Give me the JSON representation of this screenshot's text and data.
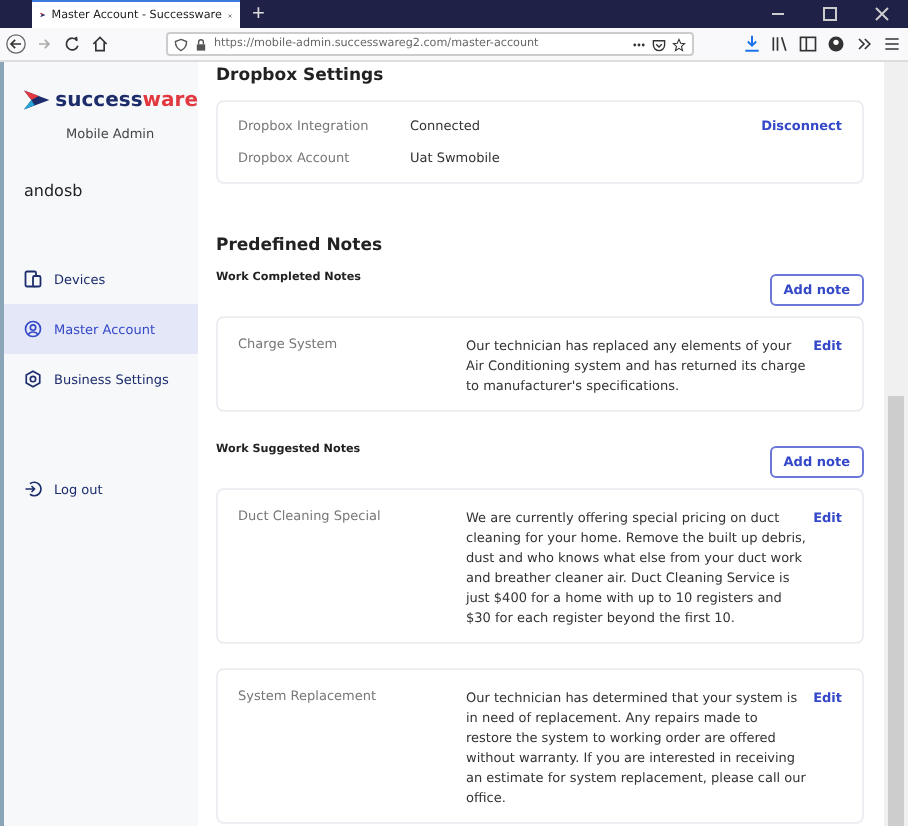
{
  "browser": {
    "tab_title": "Master Account - Successware",
    "url": "https://mobile-admin.successwareg2.com/master-account",
    "new_tab": "+"
  },
  "sidebar": {
    "logo": {
      "part_1": "success",
      "part_2": "ware"
    },
    "subtitle": "Mobile Admin",
    "user": "andosb",
    "items": [
      {
        "label": "Devices",
        "selected": false
      },
      {
        "label": "Master Account",
        "selected": true
      },
      {
        "label": "Business Settings",
        "selected": false
      }
    ],
    "logout": "Log out"
  },
  "dropbox": {
    "title": "Dropbox Settings",
    "rows": [
      {
        "label": "Dropbox Integration",
        "value": "Connected",
        "action": "Disconnect"
      },
      {
        "label": "Dropbox Account",
        "value": "Uat Swmobile"
      }
    ]
  },
  "notes": {
    "title": "Predefined Notes",
    "groups": [
      {
        "title": "Work Completed Notes",
        "button": "Add note",
        "items": [
          {
            "name": "Charge System",
            "text": "Our technician has replaced any elements of your Air Conditioning system and has returned its charge to manufacturer's specifications.",
            "action": "Edit"
          }
        ]
      },
      {
        "title": "Work Suggested Notes",
        "button": "Add note",
        "items": [
          {
            "name": "Duct Cleaning Special",
            "text": "We are currently offering special pricing on duct cleaning for your home. Remove the built up debris, dust and who knows what else from your duct work and breather cleaner air. Duct Cleaning Service is just $400 for a home with up to 10 registers and $30 for each register beyond the first 10.",
            "action": "Edit"
          },
          {
            "name": "System Replacement",
            "text": "Our technician has determined that your system is in need of replacement. Any repairs made to restore the system to working order are offered without warranty. If you are interested in receiving an estimate for system replacement, please call our office.",
            "action": "Edit"
          }
        ]
      }
    ]
  }
}
